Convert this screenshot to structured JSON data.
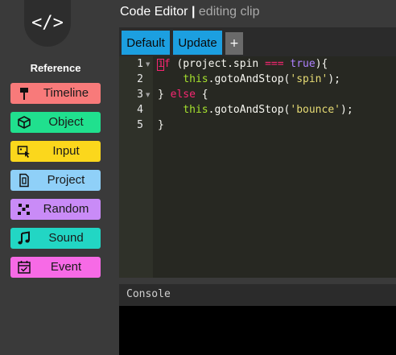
{
  "header": {
    "app_title": "Code Editor",
    "separator": "|",
    "subtitle": "editing clip"
  },
  "sidebar": {
    "logo": "</>",
    "reference_title": "Reference",
    "items": [
      {
        "label": "Timeline",
        "icon": "pin-icon",
        "color": "#f87a7a"
      },
      {
        "label": "Object",
        "icon": "cube-icon",
        "color": "#20e08e"
      },
      {
        "label": "Input",
        "icon": "keyboard-pointer-icon",
        "color": "#fbd71c"
      },
      {
        "label": "Project",
        "icon": "file-icon",
        "color": "#8fd0f8"
      },
      {
        "label": "Random",
        "icon": "random-dots-icon",
        "color": "#c98bf7"
      },
      {
        "label": "Sound",
        "icon": "music-note-icon",
        "color": "#22d6c4"
      },
      {
        "label": "Event",
        "icon": "calendar-check-icon",
        "color": "#f76ae6"
      }
    ]
  },
  "tabs": {
    "default_label": "Default",
    "update_label": "Update",
    "add_label": "+"
  },
  "editor": {
    "line_numbers": [
      "1",
      "2",
      "3",
      "4",
      "5"
    ],
    "lines": [
      "if (project.spin === true){",
      "    this.gotoAndStop('spin');",
      "} else {",
      "    this.gotoAndStop('bounce');",
      "}"
    ]
  },
  "console": {
    "title": "Console"
  },
  "colors": {
    "tab_blue": "#1c9fe0",
    "editor_bg": "#272822",
    "keyword": "#f92672",
    "string": "#e6db74",
    "boolean": "#ae81ff"
  }
}
